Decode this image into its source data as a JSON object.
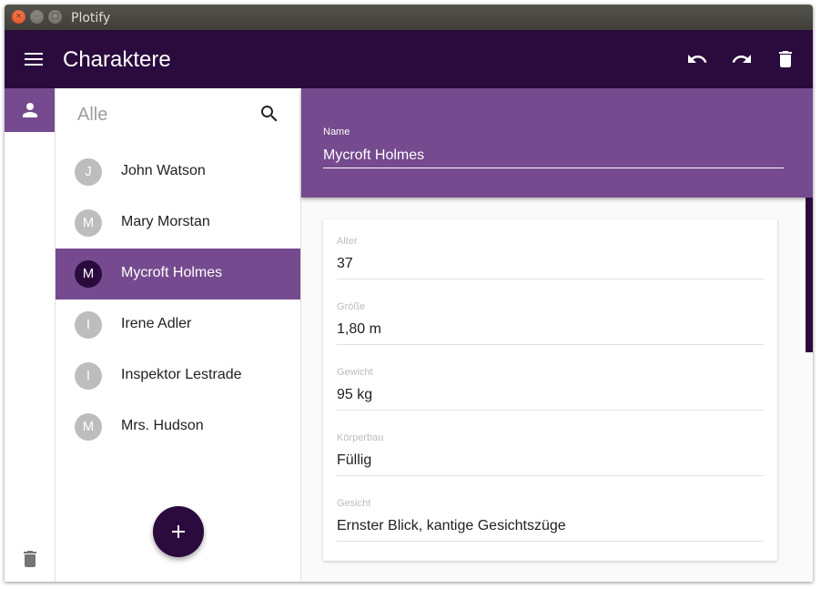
{
  "window": {
    "title": "Plotify",
    "close_glyph": "×",
    "min_glyph": "–",
    "max_glyph": "□"
  },
  "appbar": {
    "title": "Charaktere",
    "background": "#2b0a3d",
    "icons": [
      "menu-icon",
      "undo-icon",
      "redo-icon",
      "delete-icon"
    ]
  },
  "rail": {
    "items": [
      {
        "icon": "person-icon",
        "selected": true
      }
    ],
    "bottom_icon": "delete-icon"
  },
  "list": {
    "filter_label": "Alle",
    "search_icon": "search-icon",
    "items": [
      {
        "initial": "J",
        "name": "John Watson",
        "selected": false
      },
      {
        "initial": "M",
        "name": "Mary Morstan",
        "selected": false
      },
      {
        "initial": "M",
        "name": "Mycroft Holmes",
        "selected": true
      },
      {
        "initial": "I",
        "name": "Irene Adler",
        "selected": false
      },
      {
        "initial": "I",
        "name": "Inspektor Lestrade",
        "selected": false
      },
      {
        "initial": "M",
        "name": "Mrs. Hudson",
        "selected": false
      }
    ],
    "fab_icon": "add-icon"
  },
  "detail": {
    "name_label": "Name",
    "name_value": "Mycroft Holmes",
    "fields": [
      {
        "label": "Alter",
        "value": "37"
      },
      {
        "label": "Größe",
        "value": "1,80 m"
      },
      {
        "label": "Gewicht",
        "value": "95 kg"
      },
      {
        "label": "Körperbau",
        "value": "Füllig"
      },
      {
        "label": "Gesicht",
        "value": "Ernster Blick, kantige Gesichtszüge"
      }
    ]
  },
  "colors": {
    "primary_dark": "#2b0a3d",
    "primary": "#754a8e",
    "avatar_grey": "#bdbdbd"
  }
}
